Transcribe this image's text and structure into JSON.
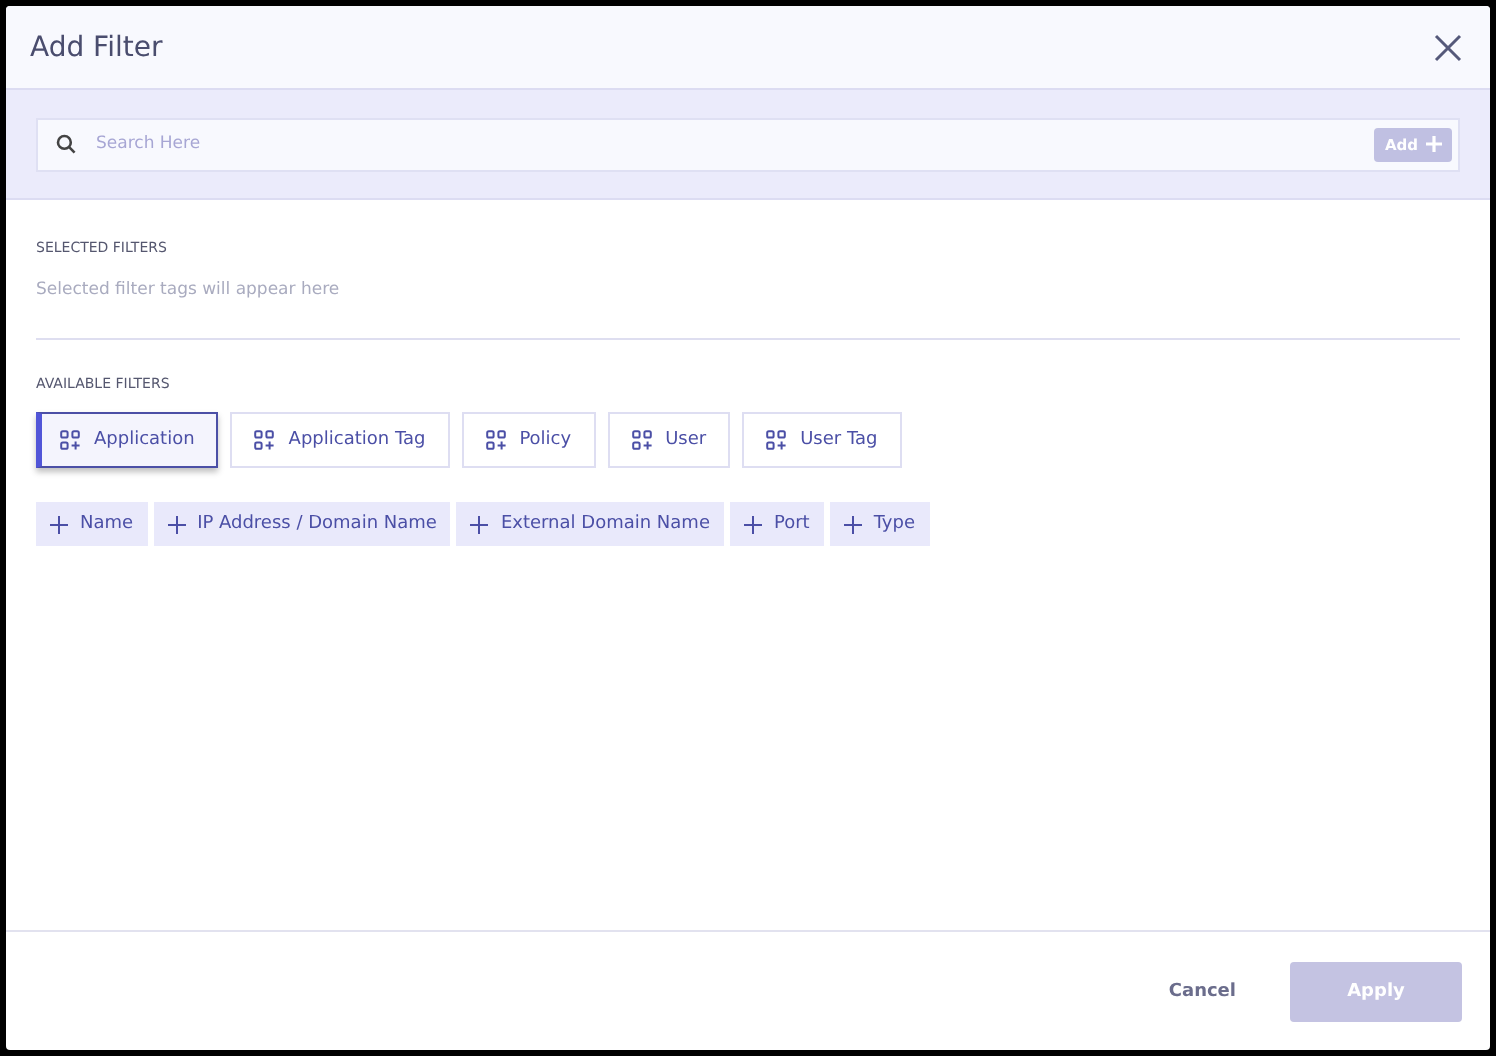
{
  "dialog": {
    "title": "Add Filter"
  },
  "search": {
    "placeholder": "Search Here",
    "add_button": {
      "label": "Add",
      "disabled": true
    }
  },
  "selected_filters": {
    "heading": "SELECTED FILTERS",
    "empty_text": "Selected filter tags will appear here"
  },
  "available_filters": {
    "heading": "AVAILABLE FILTERS",
    "categories": [
      {
        "label": "Application",
        "selected": true
      },
      {
        "label": "Application Tag",
        "selected": false
      },
      {
        "label": "Policy",
        "selected": false
      },
      {
        "label": "User",
        "selected": false
      },
      {
        "label": "User Tag",
        "selected": false
      }
    ],
    "fields": [
      "Name",
      "IP Address / Domain Name",
      "External Domain Name",
      "Port",
      "Type"
    ]
  },
  "footer": {
    "cancel": "Cancel",
    "apply": {
      "label": "Apply",
      "disabled": true
    }
  }
}
